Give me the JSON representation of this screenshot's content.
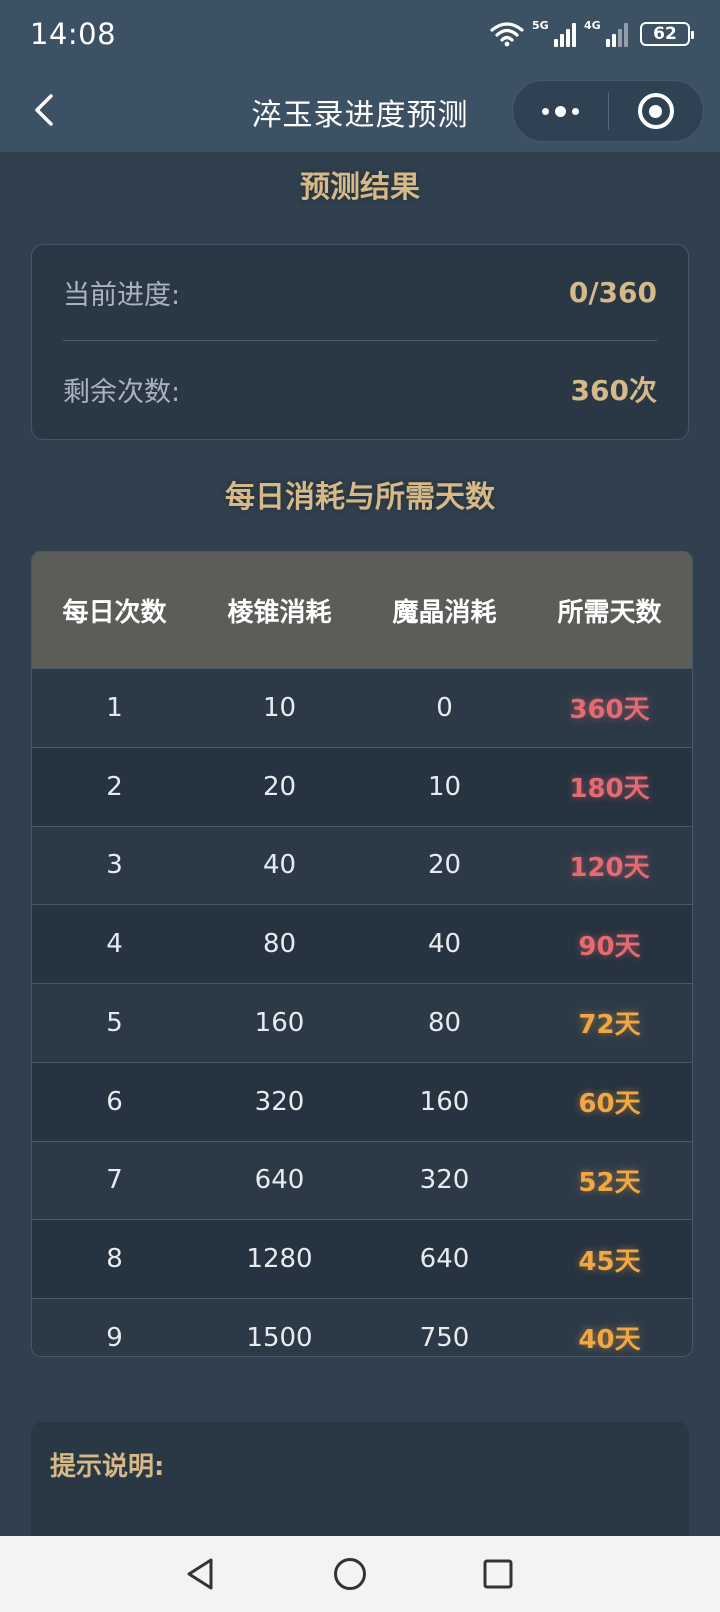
{
  "status_bar": {
    "time": "14:08",
    "network_1": "5G",
    "network_2": "4G",
    "battery": "62"
  },
  "nav": {
    "title": "淬玉录进度预测",
    "icons": [
      "back-arrow-icon",
      "more-dots-icon",
      "record-target-icon"
    ]
  },
  "result": {
    "title": "预测结果",
    "current_label": "当前进度:",
    "current_value": "0/360",
    "remaining_label": "剩余次数:",
    "remaining_value": "360次"
  },
  "daily": {
    "title": "每日消耗与所需天数",
    "headers": [
      "每日次数",
      "棱锥消耗",
      "魔晶消耗",
      "所需天数"
    ],
    "rows": [
      [
        "1",
        "10",
        "0",
        "360天"
      ],
      [
        "2",
        "20",
        "10",
        "180天"
      ],
      [
        "3",
        "40",
        "20",
        "120天"
      ],
      [
        "4",
        "80",
        "40",
        "90天"
      ],
      [
        "5",
        "160",
        "80",
        "72天"
      ],
      [
        "6",
        "320",
        "160",
        "60天"
      ],
      [
        "7",
        "640",
        "320",
        "52天"
      ],
      [
        "8",
        "1280",
        "640",
        "45天"
      ],
      [
        "9",
        "1500",
        "750",
        "40天"
      ]
    ]
  },
  "tips": {
    "title": "提示说明:"
  },
  "colors": {
    "accent_gold": "#d6b988",
    "days_red": "#e56a72",
    "days_orange": "#f2a743",
    "header_bg": "#3c5164"
  },
  "bottom_nav": {
    "icons": [
      "back-triangle-icon",
      "home-circle-icon",
      "recents-square-icon"
    ]
  }
}
